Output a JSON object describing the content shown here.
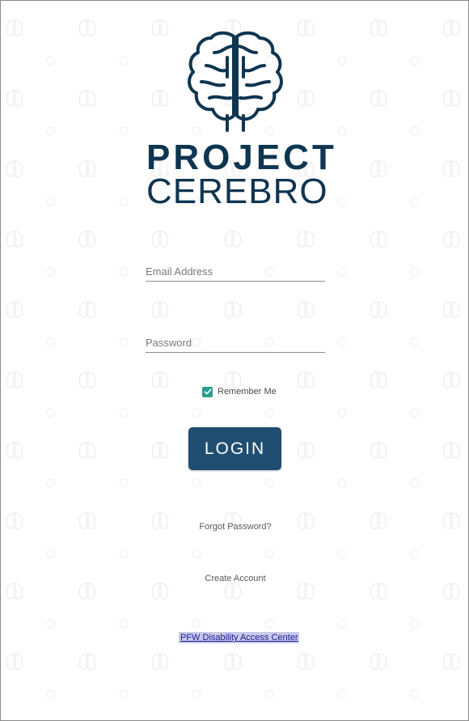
{
  "brand": {
    "line1": "PROJECT",
    "line2": "CEREBRO",
    "logo_icon": "brain-icon",
    "color": "#0f3550"
  },
  "form": {
    "email": {
      "placeholder": "Email Address",
      "value": ""
    },
    "password": {
      "placeholder": "Password",
      "value": ""
    },
    "remember_me": {
      "label": "Remember Me",
      "checked": true
    },
    "login_label": "LOGIN"
  },
  "links": {
    "forgot_password": "Forgot Password?",
    "create_account": "Create Account",
    "access_center": "PFW Disability Access Center"
  },
  "colors": {
    "accent": "#1f4e70",
    "checkbox": "#2a9d8f",
    "link": "#1a1a9a"
  }
}
